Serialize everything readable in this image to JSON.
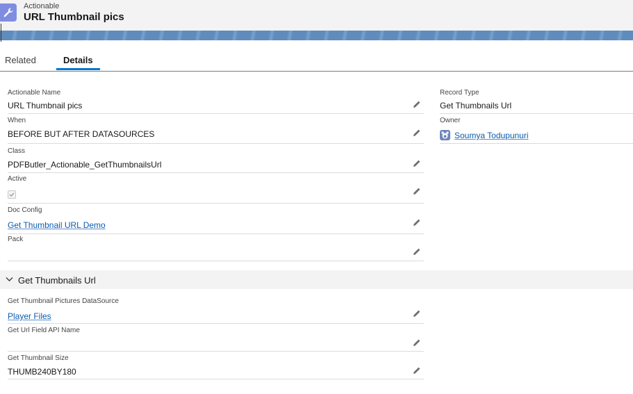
{
  "header": {
    "object_label": "Actionable",
    "record_title": "URL Thumbnail pics",
    "object_icon": "wrench-icon",
    "icon_color": "#7f8de1"
  },
  "tabs": [
    {
      "label": "Related",
      "active": false
    },
    {
      "label": "Details",
      "active": true
    }
  ],
  "accent_color": "#0176d3",
  "link_color": "#0b5cab",
  "fields_left": {
    "actionable_name": {
      "label": "Actionable Name",
      "value": "URL Thumbnail pics"
    },
    "when": {
      "label": "When",
      "value": "BEFORE BUT AFTER DATASOURCES"
    },
    "class": {
      "label": "Class",
      "value": "PDFButler_Actionable_GetThumbnailsUrl"
    },
    "active": {
      "label": "Active",
      "checked": true
    },
    "doc_config": {
      "label": "Doc Config",
      "value": "Get Thumbnail URL Demo"
    },
    "pack": {
      "label": "Pack",
      "value": ""
    }
  },
  "fields_right": {
    "record_type": {
      "label": "Record Type",
      "value": "Get Thumbnails Url"
    },
    "owner": {
      "label": "Owner",
      "value": "Soumya Todupunuri"
    }
  },
  "section": {
    "title": "Get Thumbnails Url",
    "expanded": true,
    "fields": {
      "datasource": {
        "label": "Get Thumbnail Pictures DataSource",
        "value": "Player Files"
      },
      "url_field": {
        "label": "Get Url Field API Name",
        "value": ""
      },
      "size": {
        "label": "Get Thumbnail Size",
        "value": "THUMB240BY180"
      }
    }
  }
}
